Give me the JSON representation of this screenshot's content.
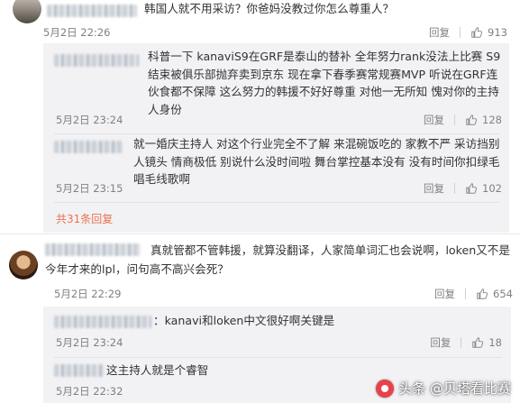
{
  "comments": [
    {
      "text": "韩国人就不用采访？你爸妈没教过你怎么尊重人？",
      "time": "5月2日 22:26",
      "reply_label": "回复",
      "likes": "913",
      "replies": [
        {
          "text": "科普一下 kanaviS9在GRF是泰山的替补 全年努力rank没法上比赛  S9结束被俱乐部抛弃卖到京东  现在拿下春季赛常规赛MVP 听说在GRF连伙食都不保障 这么努力的韩援不好好尊重 对他一无所知 愧对你的主持人身份",
          "time": "5月2日 23:24",
          "reply_label": "回复",
          "likes": "128"
        },
        {
          "text": "就一婚庆主持人 对这个行业完全不了解 来混碗饭吃的 家教不严 采访挡别人镜头 情商极低 别说什么没时间啦 舞台掌控基本没有 没有时间你扣绿毛唱毛线歌啊",
          "time": "5月2日 23:15",
          "reply_label": "回复",
          "likes": "102"
        }
      ],
      "more_replies": "共31条回复"
    },
    {
      "text": "真就管都不管韩援，就算没翻译，人家简单词汇也会说啊，loken又不是今年才来的lpl，问句高不高兴会死？",
      "time": "5月2日 22:29",
      "reply_label": "回复",
      "likes": "654",
      "replies": [
        {
          "text": "：kanavi和loken中文很好啊关键是",
          "time": "5月2日 23:24",
          "reply_label": "回复",
          "likes": "18"
        },
        {
          "text": "这主持人就是个睿智",
          "time": "5月2日 22:32"
        }
      ]
    }
  ],
  "watermark": "头条 @贝塔看比赛",
  "colors": {
    "link": "#eb7350",
    "meta": "#808080",
    "sub_bg": "#f2f2f5"
  },
  "icons": {
    "like": "thumbs-up-icon"
  }
}
